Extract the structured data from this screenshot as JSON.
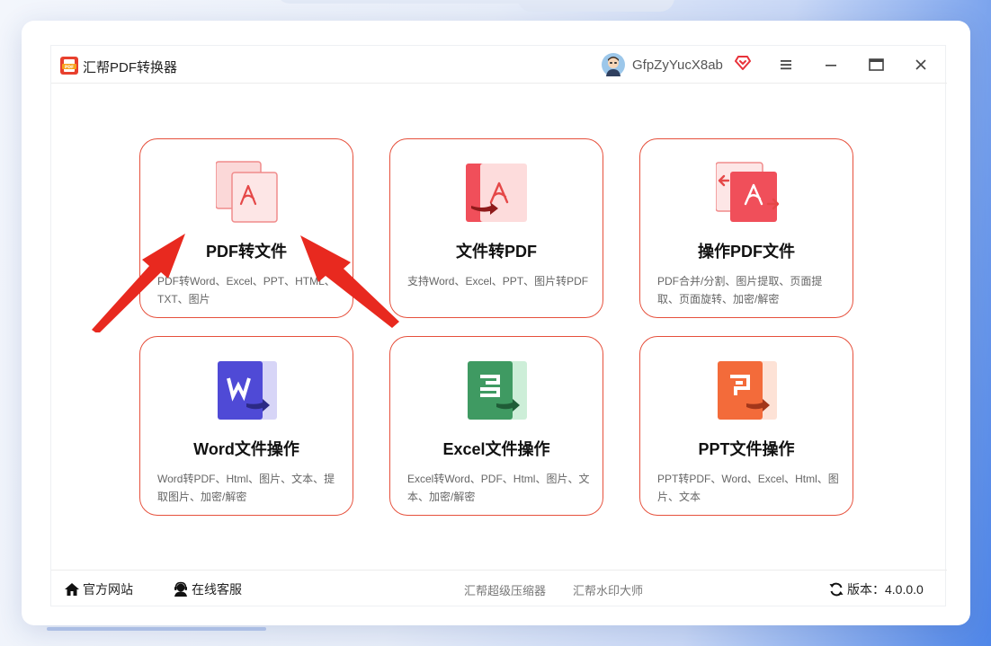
{
  "app": {
    "title": "汇帮PDF转换器",
    "username": "GfpZyYucX8ab"
  },
  "window_controls": [
    "menu-icon",
    "minimize-icon",
    "maximize-icon",
    "close-icon"
  ],
  "cards": [
    {
      "title": "PDF转文件",
      "desc": "PDF转Word、Excel、PPT、HTML、TXT、图片",
      "icon": "pdf-to-file-icon"
    },
    {
      "title": "文件转PDF",
      "desc": "支持Word、Excel、PPT、图片转PDF",
      "icon": "file-to-pdf-icon"
    },
    {
      "title": "操作PDF文件",
      "desc": "PDF合并/分割、图片提取、页面提取、页面旋转、加密/解密",
      "icon": "pdf-operate-icon"
    },
    {
      "title": "Word文件操作",
      "desc": "Word转PDF、Html、图片、文本、提取图片、加密/解密",
      "icon": "word-icon"
    },
    {
      "title": "Excel文件操作",
      "desc": "Excel转Word、PDF、Html、图片、文本、加密/解密",
      "icon": "excel-icon"
    },
    {
      "title": "PPT文件操作",
      "desc": "PPT转PDF、Word、Excel、Html、图片、文本",
      "icon": "ppt-icon"
    }
  ],
  "footer": {
    "official_site": "官方网站",
    "online_service": "在线客服",
    "link1": "汇帮超级压缩器",
    "link2": "汇帮水印大师",
    "version": "版本：4.0.0.0"
  },
  "colors": {
    "accent": "#e6503c",
    "pdf_red": "#f04f5a",
    "word_blue": "#4f4ad6",
    "excel_green": "#3f9a62",
    "ppt_orange": "#f36b3a"
  }
}
